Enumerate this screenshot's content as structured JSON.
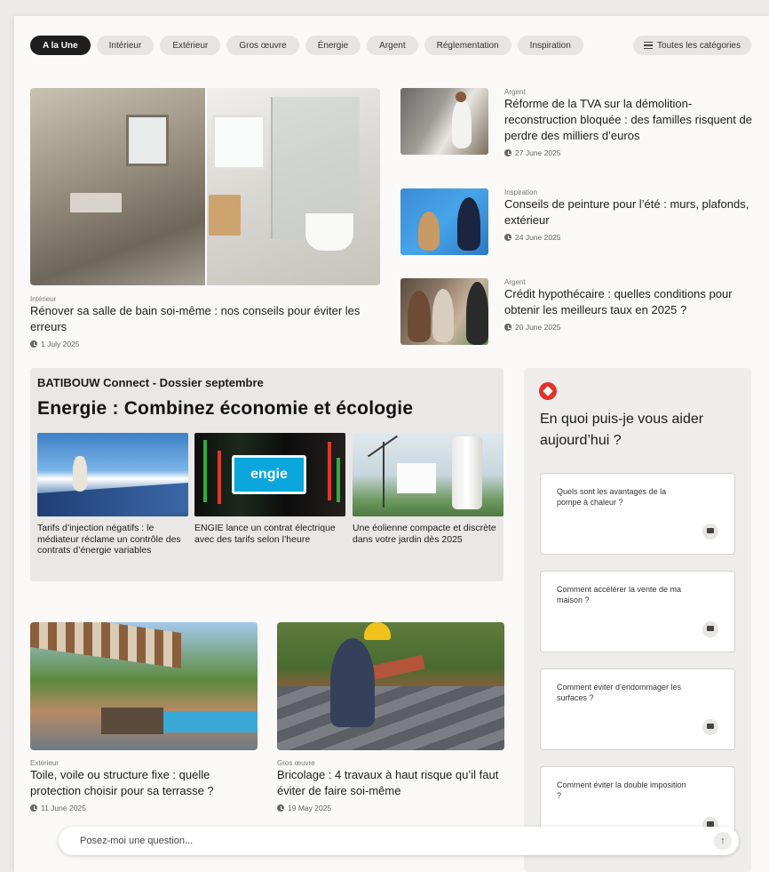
{
  "chips": [
    "A la Une",
    "Intérieur",
    "Extérieur",
    "Gros œuvre",
    "Énergie",
    "Argent",
    "Réglementation",
    "Inspiration"
  ],
  "all_categories": "Toutes les catégories",
  "hero": {
    "category": "Intérieur",
    "title": "Rénover sa salle de bain soi-même : nos conseils pour éviter les erreurs",
    "date": "1 July 2025"
  },
  "side_articles": [
    {
      "category": "Argent",
      "title": "Réforme de la TVA sur la démolition-reconstruction bloquée : des familles risquent de perdre des milliers d’euros",
      "date": "27 June 2025"
    },
    {
      "category": "Inspiration",
      "title": "Conseils de peinture pour l’été : murs, plafonds, extérieur",
      "date": "24 June 2025"
    },
    {
      "category": "Argent",
      "title": "Crédit hypothécaire : quelles conditions pour obtenir les meilleurs taux en 2025 ?",
      "date": "20 June 2025"
    }
  ],
  "dossier": {
    "kicker": "BATIBOUW Connect - Dossier septembre",
    "title": "Energie : Combinez économie et écologie",
    "cards": [
      {
        "text": "Tarifs d’injection négatifs : le médiateur réclame un contrôle des contrats d’énergie variables"
      },
      {
        "text": "ENGIE lance un contrat électrique avec des tarifs selon l’heure",
        "logo": "engie"
      },
      {
        "text": "Une éolienne compacte et discrète dans votre jardin dès 2025"
      }
    ]
  },
  "chat": {
    "question": "En quoi puis-je vous aider aujourd’hui ?",
    "suggestions": [
      "Quels sont les avantages de la pompe à chaleur ?",
      "Comment accélérer la vente de ma maison ?",
      "Comment éviter d’endommager les surfaces ?",
      "Comment éviter la double imposition ?"
    ]
  },
  "bottom_articles": [
    {
      "category": "Extérieur",
      "title": "Toile, voile ou structure fixe : quelle protection choisir pour sa terrasse ?",
      "date": "11 June 2025"
    },
    {
      "category": "Gros œuvre",
      "title": "Bricolage : 4 travaux à haut risque qu’il faut éviter de faire soi-même",
      "date": "19 May 2025"
    }
  ],
  "ask_bar": {
    "placeholder": "Posez-moi une question..."
  },
  "colors": {
    "accent": "#e1322c",
    "chip_active": "#1e1e1e",
    "chip": "#e6e5e1"
  }
}
